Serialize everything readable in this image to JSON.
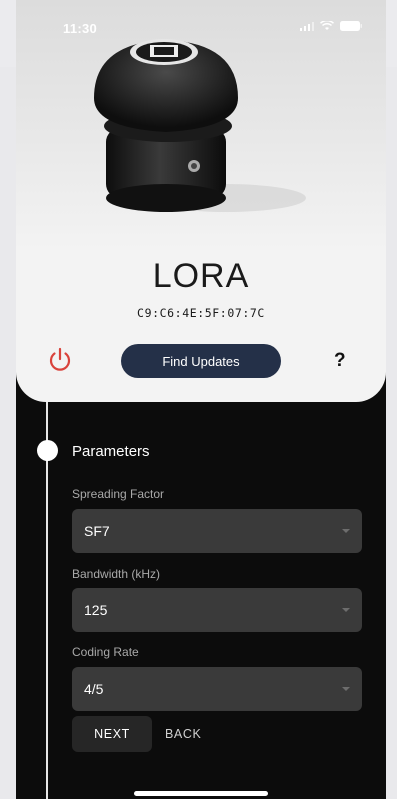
{
  "status_bar": {
    "time": "11:30"
  },
  "device": {
    "name": "LORA",
    "mac": "C9:C6:4E:5F:07:7C"
  },
  "actions": {
    "find_updates": "Find Updates",
    "help": "?"
  },
  "step": {
    "title": "Parameters"
  },
  "fields": [
    {
      "label": "Spreading Factor",
      "value": "SF7"
    },
    {
      "label": "Bandwidth (kHz)",
      "value": "125"
    },
    {
      "label": "Coding Rate",
      "value": "4/5"
    }
  ],
  "buttons": {
    "next": "NEXT",
    "back": "BACK"
  },
  "colors": {
    "find_button_bg": "#243048",
    "power_icon": "#d9433c"
  }
}
